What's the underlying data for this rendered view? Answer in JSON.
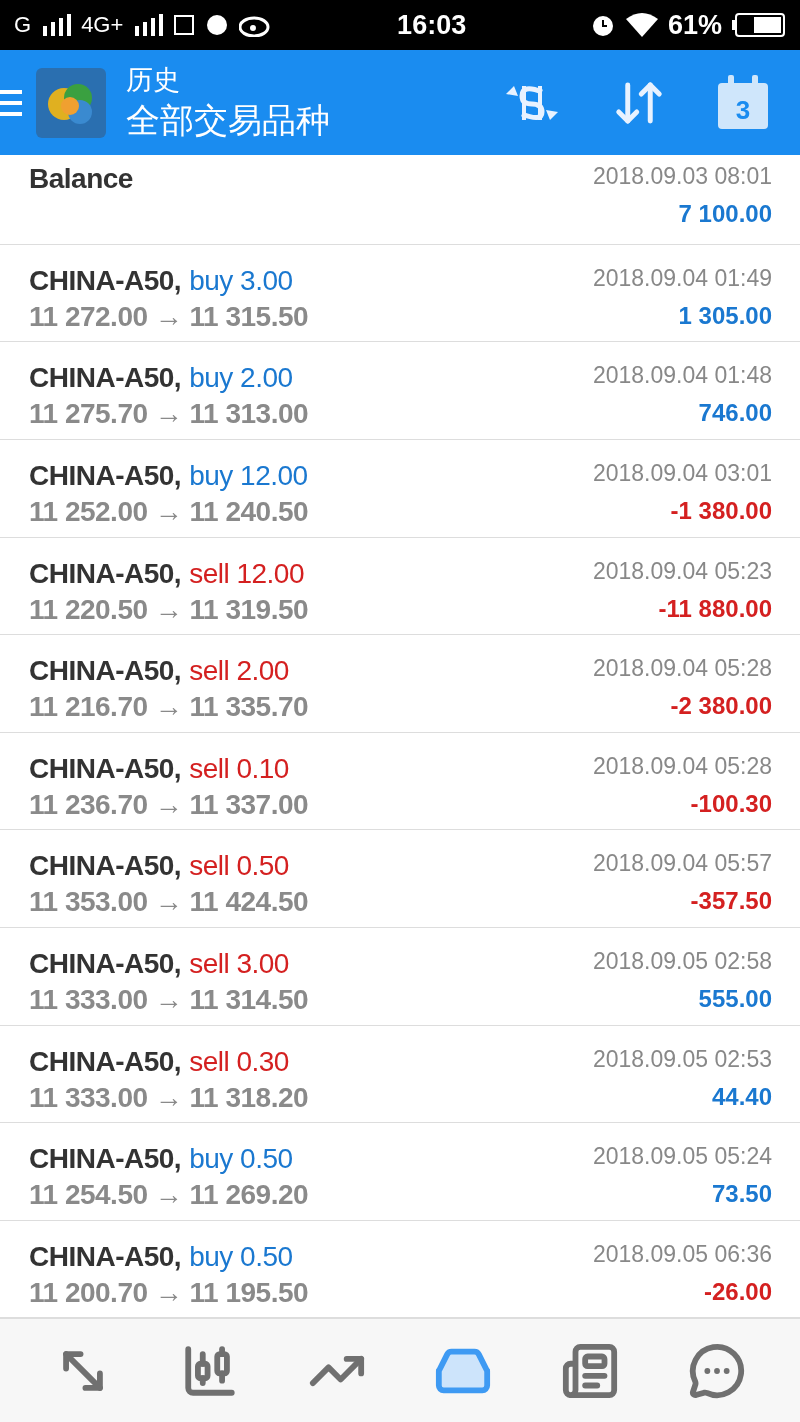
{
  "status_bar": {
    "carrier_1": "G",
    "carrier_2": "4G+",
    "time": "16:03",
    "battery": "61%"
  },
  "header": {
    "title": "历史",
    "subtitle": "全部交易品种",
    "calendar_day": "3"
  },
  "rows": [
    {
      "kind": "balance",
      "label": "Balance",
      "time": "2018.09.03 08:01",
      "amount": "7 100.00",
      "positive": true
    },
    {
      "kind": "trade",
      "symbol": "CHINA-A50,",
      "side": "buy",
      "volume": "3.00",
      "prices": "11 272.00 → 11 315.50",
      "time": "2018.09.04 01:49",
      "amount": "1 305.00",
      "positive": true
    },
    {
      "kind": "trade",
      "symbol": "CHINA-A50,",
      "side": "buy",
      "volume": "2.00",
      "prices": "11 275.70 → 11 313.00",
      "time": "2018.09.04 01:48",
      "amount": "746.00",
      "positive": true
    },
    {
      "kind": "trade",
      "symbol": "CHINA-A50,",
      "side": "buy",
      "volume": "12.00",
      "prices": "11 252.00 → 11 240.50",
      "time": "2018.09.04 03:01",
      "amount": "-1 380.00",
      "positive": false
    },
    {
      "kind": "trade",
      "symbol": "CHINA-A50,",
      "side": "sell",
      "volume": "12.00",
      "prices": "11 220.50 → 11 319.50",
      "time": "2018.09.04 05:23",
      "amount": "-11 880.00",
      "positive": false
    },
    {
      "kind": "trade",
      "symbol": "CHINA-A50,",
      "side": "sell",
      "volume": "2.00",
      "prices": "11 216.70 → 11 335.70",
      "time": "2018.09.04 05:28",
      "amount": "-2 380.00",
      "positive": false
    },
    {
      "kind": "trade",
      "symbol": "CHINA-A50,",
      "side": "sell",
      "volume": "0.10",
      "prices": "11 236.70 → 11 337.00",
      "time": "2018.09.04 05:28",
      "amount": "-100.30",
      "positive": false
    },
    {
      "kind": "trade",
      "symbol": "CHINA-A50,",
      "side": "sell",
      "volume": "0.50",
      "prices": "11 353.00 → 11 424.50",
      "time": "2018.09.04 05:57",
      "amount": "-357.50",
      "positive": false
    },
    {
      "kind": "trade",
      "symbol": "CHINA-A50,",
      "side": "sell",
      "volume": "3.00",
      "prices": "11 333.00 → 11 314.50",
      "time": "2018.09.05 02:58",
      "amount": "555.00",
      "positive": true
    },
    {
      "kind": "trade",
      "symbol": "CHINA-A50,",
      "side": "sell",
      "volume": "0.30",
      "prices": "11 333.00 → 11 318.20",
      "time": "2018.09.05 02:53",
      "amount": "44.40",
      "positive": true
    },
    {
      "kind": "trade",
      "symbol": "CHINA-A50,",
      "side": "buy",
      "volume": "0.50",
      "prices": "11 254.50 → 11 269.20",
      "time": "2018.09.05 05:24",
      "amount": "73.50",
      "positive": true
    },
    {
      "kind": "trade",
      "symbol": "CHINA-A50,",
      "side": "buy",
      "volume": "0.50",
      "prices": "11 200.70 → 11 195.50",
      "time": "2018.09.05 06:36",
      "amount": "-26.00",
      "positive": false
    }
  ],
  "bottom_nav": [
    {
      "kind": "quotes",
      "selected": false
    },
    {
      "kind": "charts",
      "selected": false
    },
    {
      "kind": "trade",
      "selected": false
    },
    {
      "kind": "history",
      "selected": true
    },
    {
      "kind": "news",
      "selected": false
    },
    {
      "kind": "chat",
      "selected": false
    }
  ]
}
